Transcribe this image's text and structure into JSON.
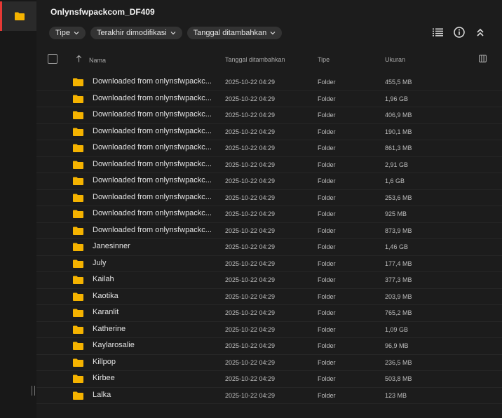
{
  "folder_title": "Onlynsfwpackcom_DF409",
  "filters": [
    {
      "label": "Tipe"
    },
    {
      "label": "Terakhir dimodifikasi"
    },
    {
      "label": "Tanggal ditambahkan"
    }
  ],
  "toolbar_icons": [
    "list-view-icon",
    "info-icon",
    "collapse-icon"
  ],
  "columns": {
    "name": "Nama",
    "date_added": "Tanggal ditambahkan",
    "type": "Tipe",
    "size": "Ukuran"
  },
  "colors": {
    "accent": "#e53935",
    "folder": "#f5b300"
  },
  "rows": [
    {
      "name": "Downloaded from onlynsfwpackc...",
      "date": "2025-10-22 04:29",
      "type": "Folder",
      "size": "455,5 MB"
    },
    {
      "name": "Downloaded from onlynsfwpackc...",
      "date": "2025-10-22 04:29",
      "type": "Folder",
      "size": "1,96 GB"
    },
    {
      "name": "Downloaded from onlynsfwpackc...",
      "date": "2025-10-22 04:29",
      "type": "Folder",
      "size": "406,9 MB"
    },
    {
      "name": "Downloaded from onlynsfwpackc...",
      "date": "2025-10-22 04:29",
      "type": "Folder",
      "size": "190,1 MB"
    },
    {
      "name": "Downloaded from onlynsfwpackc...",
      "date": "2025-10-22 04:29",
      "type": "Folder",
      "size": "861,3 MB"
    },
    {
      "name": "Downloaded from onlynsfwpackc...",
      "date": "2025-10-22 04:29",
      "type": "Folder",
      "size": "2,91 GB"
    },
    {
      "name": "Downloaded from onlynsfwpackc...",
      "date": "2025-10-22 04:29",
      "type": "Folder",
      "size": "1,6 GB"
    },
    {
      "name": "Downloaded from onlynsfwpackc...",
      "date": "2025-10-22 04:29",
      "type": "Folder",
      "size": "253,6 MB"
    },
    {
      "name": "Downloaded from onlynsfwpackc...",
      "date": "2025-10-22 04:29",
      "type": "Folder",
      "size": "925 MB"
    },
    {
      "name": "Downloaded from onlynsfwpackc...",
      "date": "2025-10-22 04:29",
      "type": "Folder",
      "size": "873,9 MB"
    },
    {
      "name": "Janesinner",
      "date": "2025-10-22 04:29",
      "type": "Folder",
      "size": "1,46 GB"
    },
    {
      "name": "July",
      "date": "2025-10-22 04:29",
      "type": "Folder",
      "size": "177,4 MB"
    },
    {
      "name": "Kailah",
      "date": "2025-10-22 04:29",
      "type": "Folder",
      "size": "377,3 MB"
    },
    {
      "name": "Kaotika",
      "date": "2025-10-22 04:29",
      "type": "Folder",
      "size": "203,9 MB"
    },
    {
      "name": "Karanlit",
      "date": "2025-10-22 04:29",
      "type": "Folder",
      "size": "765,2 MB"
    },
    {
      "name": "Katherine",
      "date": "2025-10-22 04:29",
      "type": "Folder",
      "size": "1,09 GB"
    },
    {
      "name": "Kaylarosalie",
      "date": "2025-10-22 04:29",
      "type": "Folder",
      "size": "96,9 MB"
    },
    {
      "name": "Killpop",
      "date": "2025-10-22 04:29",
      "type": "Folder",
      "size": "236,5 MB"
    },
    {
      "name": "Kirbee",
      "date": "2025-10-22 04:29",
      "type": "Folder",
      "size": "503,8 MB"
    },
    {
      "name": "Lalka",
      "date": "2025-10-22 04:29",
      "type": "Folder",
      "size": "123 MB"
    }
  ]
}
